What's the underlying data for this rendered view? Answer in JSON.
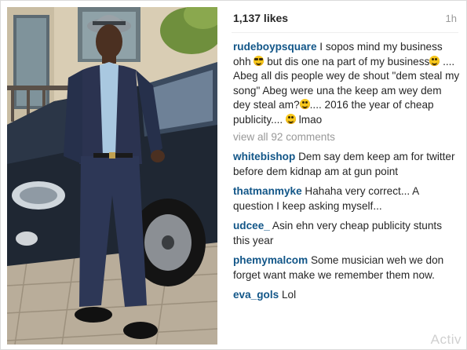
{
  "post": {
    "likes": "1,137 likes",
    "time": "1h"
  },
  "caption": {
    "user": "rudeboypsquare",
    "parts": [
      "I sopos mind my business ohh",
      "but dis one na part of my business",
      ".... Abeg all dis people wey de shout \"dem steal my song\" Abeg were una the keep am wey dem dey steal am?",
      ".... 2016 the year of cheap publicity....",
      "lmao"
    ]
  },
  "view_all": "view all 92 comments",
  "comments": [
    {
      "user": "whitebishop",
      "text": "Dem say dem keep am for twitter before dem kidnap am at gun point"
    },
    {
      "user": "thatmanmyke",
      "text": "Hahaha very correct... A question I keep asking myself..."
    },
    {
      "user": "udcee_",
      "text": "Asin ehn very cheap publicity stunts this year"
    },
    {
      "user": "phemymalcom",
      "text": "Some musician weh we don forget want make we remember them now."
    },
    {
      "user": "eva_gols",
      "text": "Lol"
    }
  ],
  "watermark": "Activ",
  "colors": {
    "username": "#125688",
    "text": "#262626",
    "muted": "#999999"
  }
}
